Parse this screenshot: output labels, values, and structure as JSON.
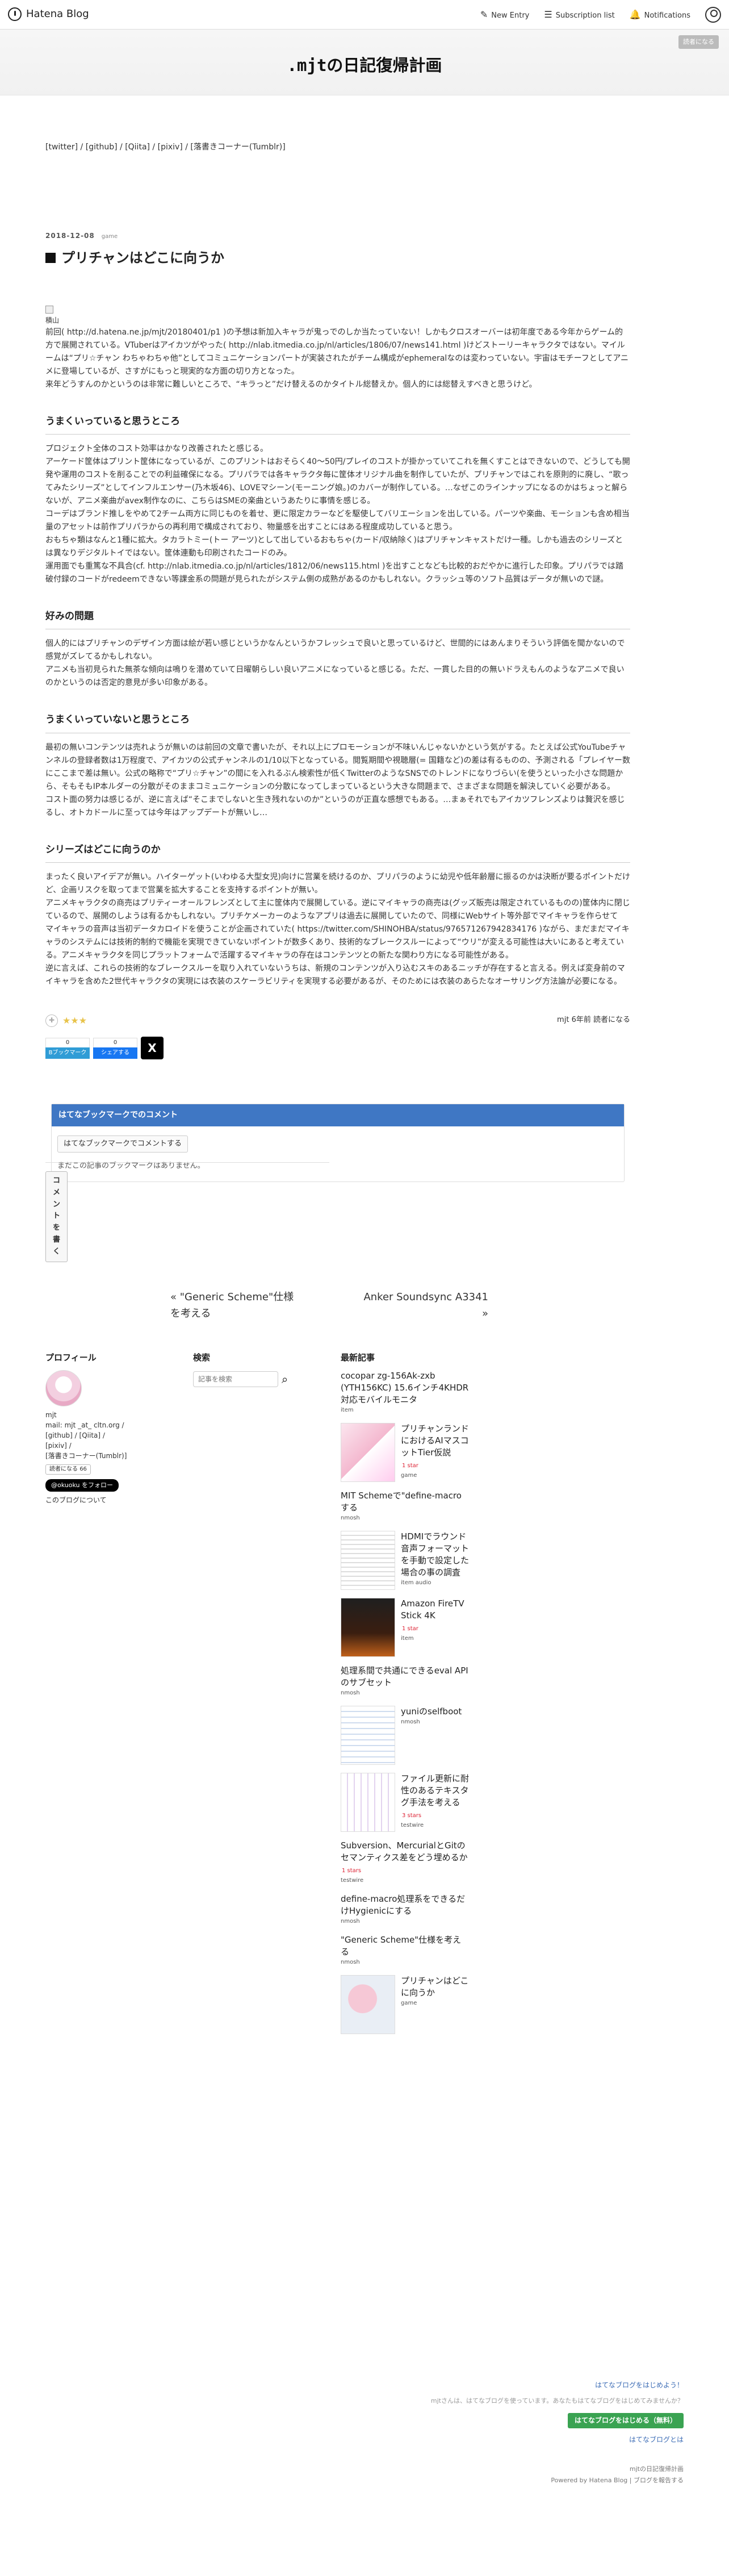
{
  "topbar": {
    "brand": "Hatena Blog",
    "new_entry": "New Entry",
    "subscription": "Subscription list",
    "notifications": "Notifications"
  },
  "header": {
    "title": ".mjtの日記復帰計画",
    "reader_button": "読者になる"
  },
  "intro_links": [
    "[twitter]",
    "[github]",
    "[Qiita]",
    "[pixiv]",
    "[落書きコーナー(Tumblr)]"
  ],
  "post": {
    "date": "2018-12-08",
    "category": "game",
    "title": "プリチャンはどこに向うか",
    "image_alt": "積山",
    "paragraphs": [
      "前回( http://d.hatena.ne.jp/mjt/20180401/p1 )の予想は新加入キャラが鬼っでのしか当たっていない！しかもクロスオーバーは初年度である今年からゲーム的方で展開されている。VTuberはアイカツがやった( http://nlab.itmedia.co.jp/nl/articles/1806/07/news141.html )けどストーリーキャラクタではない。マイルームは“プリ☆チャン わちゃわちゃ他”としてコミュニケーションパートが実装されたがチーム構成がephemeralなのは変わっていない。宇宙はモチーフとしてアニメに登場しているが、さすがにもっと現実的な方面の切り方となった。",
      "来年どうすんのかというのは非常に難しいところで、“キラっと”だけ替えるのかタイトル総替えか。個人的には総替えすべきと思うけど。"
    ],
    "sections": [
      {
        "h": "うまくいっていると思うところ",
        "p": [
          "プロジェクト全体のコスト効率はかなり改善されたと感じる。",
          "アーケード筐体はプリント筐体になっているが、このプリントはおそらく40〜50円/プレイのコストが掛かっていてこれを無くすことはできないので、どうしても開発や運用のコストを削ることでの利益確保になる。プリパラでは各キャラクタ毎に筐体オリジナル曲を制作していたが、プリチャンではこれを原則的に廃し、“歌ってみたシリーズ”としてインフルエンサー(乃木坂46)、LOVEマシーン(モーニング娘。)のカバーが制作している。…なぜこのラインナップになるのかはちょっと解らないが、アニメ楽曲がavex制作なのに、こちらはSMEの楽曲というあたりに事情を感じる。",
          "コーデはブランド推しをやめて2チーム両方に同じものを着せ、更に限定カラーなどを駆使してバリエーションを出している。パーツや楽曲、モーションも含め相当量のアセットは前作プリパラからの再利用で構成されており、物量感を出すことにはある程度成功していると思う。",
          "おもちゃ類はなんと1種に拡大。タカラトミー(トー アーツ)として出しているおもちゃ(カード/収納除く)はプリチャンキャストだけ一種。しかも過去のシリーズとは異なりデジタルトイではない。筐体連動も印刷されたコードのみ。",
          "運用面でも重篤な不具合(cf. http://nlab.itmedia.co.jp/nl/articles/1812/06/news115.html )を出すことなども比較的おだやかに進行した印象。プリパラでは踏破付録のコードがredeemできない等課金系の問題が見られたがシステム側の成熟があるのかもしれない。クラッシュ等のソフト品質はデータが無いので謎。"
        ]
      },
      {
        "h": "好みの問題",
        "p": [
          "個人的にはプリチャンのデザイン方面は絵が若い感じというかなんというかフレッシュで良いと思っているけど、世間的にはあんまりそういう評価を聞かないので感覚がズレてるかもしれない。",
          "アニメも当初見られた無茶な傾向は鳴りを潜めていて日曜朝らしい良いアニメになっていると感じる。ただ、一貫した目的の無いドラえもんのようなアニメで良いのかというのは否定的意見が多い印象がある。"
        ]
      },
      {
        "h": "うまくいっていないと思うところ",
        "p": [
          "最初の無いコンテンツは売れようが無いのは前回の文章で書いたが、それ以上にプロモーションが不味いんじゃないかという気がする。たとえば公式YouTubeチャンネルの登録者数は1万程度で、アイカツの公式チャンネルの1/10以下となっている。閲覧期間や視聴層(= 国籍など)の差は有るものの、予測される「プレイヤー数にここまで差は無い。公式の略称で“プリ☆チャン”の間にを入れるぶん検索性が低くTwitterのようなSNSでのトレンドになりづらい(を使うといった小さな問題から、そもそもIP本ルダーの分散がそのままコミュニケーションの分散になってしまっているという大きな問題まで、さまざまな問題を解決していく必要がある。",
          "コスト面の努力は感じるが、逆に言えば“そこまでしないと生き残れないのか”というのが正直な感想でもある。…まぁそれでもアイカツフレンズよりは贅沢を感じるし、オトカドールに至っては今年はアップデートが無いし…"
        ]
      },
      {
        "h": "シリーズはどこに向うのか",
        "p": [
          "まったく良いアイデアが無い。ハイターゲット(いわゆる大型女児)向けに営業を続けるのか、プリパラのように幼児や低年齢層に振るのかは決断が要るポイントだけど、企画リスクを取ってまで営業を拡大することを支持するポイントが無い。",
          "アニメキャラクタの商売はプリティーオールフレンズとして主に筐体内で展開している。逆にマイキャラの商売は(グッズ販売は限定されているものの)筐体内に閉じているので、展開のしようは有るかもしれない。プリチケメーカーのようなアプリは過去に展開していたので、同様にWebサイト等外部でマイキャラを作らせて",
          "マイキャラの音声は当初データカロイドを使うことが企画されていた( https://twitter.com/SHINOHBA/status/976571267942834176 )ながら、まだまだマイキャラのシステムには技術的制約で機能を実現できていないポイントが数多くあり、技術的なブレークスルーによって“ウリ”が変える可能性は大いにあると考えている。アニメキャラクタを同じプラットフォームで活躍するマイキャラの存在はコンテンツとの新たな関わり方になる可能性がある。",
          "逆に言えば、これらの技術的なブレークスルーを取り入れていないうちは、新規のコンテンツが入り込むスキのあるニッチが存在すると言える。例えば変身前のマイキャラを含めた2世代キャラクタの実現には衣装のスケーラビリティを実現する必要があるが、そのためには衣装のあらたなオーサリング方法論が必要になる。"
        ]
      }
    ],
    "author": "mjt",
    "ago": "6年前",
    "reader": "読者になる",
    "share": {
      "hatena_count": "0",
      "hatena_label": "Bブックマーク",
      "fb_count": "0",
      "fb_label": "シェアする",
      "x": "X"
    }
  },
  "bookmarks": {
    "title": "はてなブックマークでのコメント",
    "button": "はてなブックマークでコメントする",
    "empty": "まだこの記事のブックマークはありません。"
  },
  "comment_button": "コメントを書く",
  "pager": {
    "prev": "« \"Generic Scheme\"仕様を考える",
    "next": "Anker Soundsync A3341 »"
  },
  "profile": {
    "title": "プロフィール",
    "name": "mjt",
    "mail": "mail: mjt _at_ cltn.org /",
    "links": "[github] / [Qiita] /",
    "links2": "[pixiv] /",
    "tumblr": "[落書きコーナー(Tumblr)]",
    "reader_btn": "読者になる",
    "reader_count": "66",
    "x_follow": "@okuoku をフォロー",
    "about": "このブログについて"
  },
  "search": {
    "title": "検索",
    "placeholder": "記事を検索"
  },
  "recent": {
    "title": "最新記事",
    "items": [
      {
        "t": "cocopar zg-156Ak-zxb (YTH156KC) 15.6インチ4KHDR対応モバイルモニタ",
        "c": "item",
        "img": ""
      },
      {
        "t": "プリチャンランドにおけるAIマスコットTier仮説",
        "c": "game",
        "img": "th1",
        "star": "1 star"
      },
      {
        "t": "MIT Schemeで\"define-macroする",
        "c": "nmosh",
        "img": ""
      },
      {
        "t": "HDMIでラウンド音声フォーマットを手動で設定した場合の事の調査",
        "c": "item audio",
        "img": "th2"
      },
      {
        "t": "Amazon FireTV Stick 4K",
        "c": "item",
        "img": "th3",
        "star": "1 star"
      },
      {
        "t": "処理系間で共通にできるeval APIのサブセット",
        "c": "nmosh",
        "img": ""
      },
      {
        "t": "yuniのselfboot",
        "c": "nmosh",
        "img": "th4"
      },
      {
        "t": "ファイル更新に耐性のあるテキスタグ手法を考える",
        "c": "testwire",
        "img": "th5",
        "star": "3 stars"
      },
      {
        "t": "Subversion、MercurialとGitのセマンティクス差をどう埋めるか",
        "c": "testwire",
        "img": "",
        "star": "1 stars"
      },
      {
        "t": "define-macro処理系をできるだけHygienicにする",
        "c": "nmosh",
        "img": ""
      },
      {
        "t": "\"Generic Scheme\"仕様を考える",
        "c": "nmosh",
        "img": ""
      },
      {
        "t": "プリチャンはどこに向うか",
        "c": "game",
        "img": "th6"
      }
    ]
  },
  "footer": {
    "q1": "はてなブログをはじめよう！",
    "q2": "mjtさんは、はてなブログを使っています。あなたもはてなブログをはじめてみませんか？",
    "cta": "はてなブログをはじめる（無料）",
    "about": "はてなブログとは",
    "blogname": "mjtの日記復帰計画",
    "powered": "Powered by Hatena Blog | ブログを報告する"
  }
}
